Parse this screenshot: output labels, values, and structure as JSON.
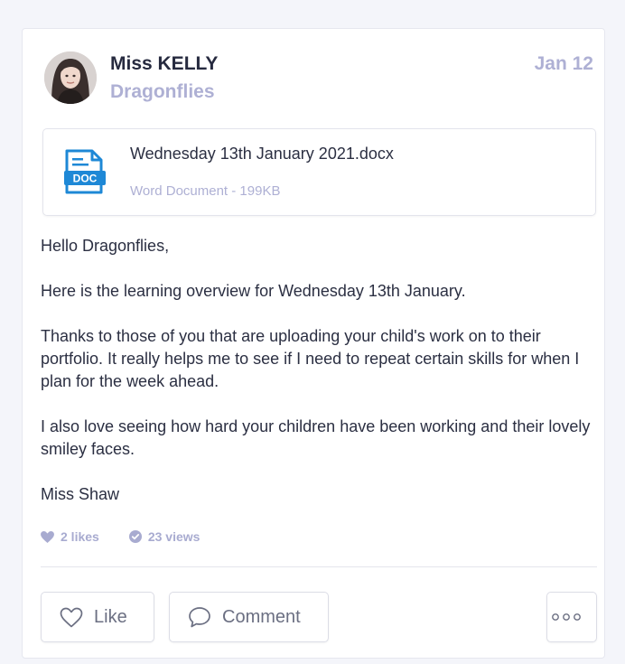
{
  "post": {
    "author": "Miss KELLY",
    "class_name": "Dragonflies",
    "date": "Jan 12",
    "attachment": {
      "icon": "doc-icon",
      "icon_label": "DOC",
      "file_name": "Wednesday 13th January 2021.docx",
      "file_meta": "Word Document - 199KB"
    },
    "body": [
      "Hello Dragonflies,",
      "Here is the learning overview for Wednesday 13th January.",
      "Thanks to those of you that are uploading your child's work on to their portfolio. It really helps me to see if I need to repeat certain skills for when I plan for the week ahead.",
      "I also love seeing how hard your children have been working and their lovely smiley faces.",
      "Miss Shaw"
    ],
    "stats": {
      "likes": "2 likes",
      "views": "23 views"
    }
  },
  "actions": {
    "like_label": "Like",
    "comment_label": "Comment",
    "more_icon": "ellipsis-icon"
  },
  "colors": {
    "accent": "#aeb0d4",
    "doc_blue": "#1e88d6",
    "text": "#2b2f42"
  }
}
